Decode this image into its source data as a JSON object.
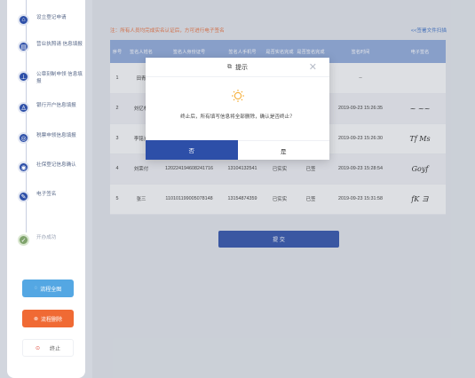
{
  "sidebar": {
    "steps": [
      {
        "label": "设立登记申请",
        "icon": "home-icon",
        "glyph": "⌂",
        "state": "active"
      },
      {
        "label": "营业执照请 信息填报",
        "icon": "license-icon",
        "glyph": "▤",
        "state": "active"
      },
      {
        "label": "公章刻制申领 信息填报",
        "icon": "stamp-icon",
        "glyph": "⊥",
        "state": "active"
      },
      {
        "label": "银行开户信息填报",
        "icon": "user-icon",
        "glyph": "♙",
        "state": "active"
      },
      {
        "label": "税票申领信息填报",
        "icon": "tax-icon",
        "glyph": "◎",
        "state": "active"
      },
      {
        "label": "社保登记信息确认",
        "icon": "social-security-icon",
        "glyph": "◉",
        "state": "active"
      },
      {
        "label": "电子签名",
        "icon": "pen-icon",
        "glyph": "✎",
        "state": "active"
      },
      {
        "label": "开办成功",
        "icon": "check-icon",
        "glyph": "✓",
        "state": "done"
      }
    ],
    "buttons": {
      "full_flow": "流程全图",
      "delete_flow": "流程删除",
      "stop": "终止"
    }
  },
  "main": {
    "notice": "注：所有人员均完成实名认证后，方可进行电子签名",
    "scan_link": "<<签署文件扫描",
    "table": {
      "headers": [
        "序号",
        "签名人姓名",
        "签名人身份证号",
        "签名人手机号",
        "是否实名完成",
        "是否签名完成",
        "签名时间",
        "电子签名"
      ],
      "rows": [
        [
          "1",
          "田青",
          "",
          "",
          "",
          "",
          "--",
          ""
        ],
        [
          "2",
          "刘亿林",
          "",
          "",
          "",
          "",
          "2019-09-23 15:26:35",
          "~ ~~"
        ],
        [
          "3",
          "李铭光",
          "",
          "",
          "",
          "",
          "2019-09-23 15:26:30",
          "Tf Ms"
        ],
        [
          "4",
          "刘荣付",
          "120224194608241716",
          "13104132541",
          "已实实",
          "已签",
          "2019-09-23 15:28:54",
          "Goyf"
        ],
        [
          "5",
          "张三",
          "110101199005078148",
          "13154874359",
          "已实实",
          "已签",
          "2019-09-23 15:31:58",
          "fK ヨ"
        ]
      ]
    },
    "submit_label": "提 交"
  },
  "modal": {
    "title": "提示",
    "message": "终止后，所有填写信息将全部删除，确认是否终止？",
    "cancel_label": "否",
    "confirm_label": "是",
    "accent_color": "#2d4fa8",
    "icon_color": "#f5a623"
  }
}
